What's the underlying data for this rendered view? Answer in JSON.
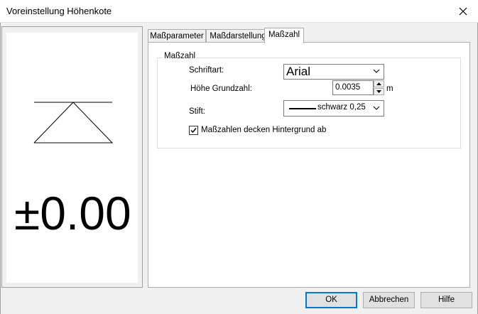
{
  "window": {
    "title": "Voreinstellung Höhenkote",
    "close_icon": "close-icon"
  },
  "preview": {
    "symbol_icon": "elevation-triangle-symbol",
    "elevation_text": "±0.00"
  },
  "tabs": [
    {
      "label": "Maßparameter",
      "active": false
    },
    {
      "label": "Maßdarstellung",
      "active": false
    },
    {
      "label": "Maßzahl",
      "active": true
    }
  ],
  "group": {
    "legend": "Maßzahl",
    "font_label": "Schriftart:",
    "font_value": "Arial",
    "height_label": "Höhe Grundzahl:",
    "height_value": "0.0035",
    "height_unit": "m",
    "pen_label": "Stift:",
    "pen_value": "schwarz 0,25",
    "checkbox_label": "Maßzahlen decken Hintergrund ab",
    "checkbox_checked": true
  },
  "buttons": {
    "ok": "OK",
    "cancel": "Abbrechen",
    "help": "Hilfe"
  },
  "colors": {
    "default_button_border": "#0078d7",
    "dialog_background": "#f0f0f0"
  }
}
